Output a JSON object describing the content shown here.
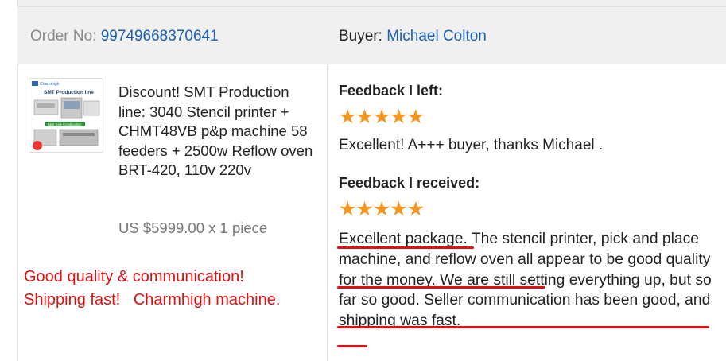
{
  "order": {
    "label": "Order No: ",
    "number": "99749668370641"
  },
  "buyer": {
    "label": "Buyer: ",
    "name": "Michael Colton"
  },
  "product": {
    "title": "Discount! SMT Production line: 3040 Stencil printer + CHMT48VB p&p machine 58 feeders + 2500w Reflow oven BRT-420, 110v 220v",
    "price": "US $5999.00 x 1 piece",
    "image": {
      "logo_text": "Charmhigh",
      "banner": "SMT Production line",
      "badge": "Best Sale Combination"
    }
  },
  "promo": {
    "line1": "Good quality & communication!",
    "line2": "Shipping fast!   Charmhigh machine."
  },
  "feedback_left": {
    "heading": "Feedback I left:",
    "rating": 5,
    "stars": "★★★★★",
    "text": "Excellent! A+++ buyer, thanks Michael ."
  },
  "feedback_received": {
    "heading": "Feedback I received:",
    "rating": 5,
    "stars": "★★★★★",
    "text": "Excellent package. The stencil printer, pick and place machine, and reflow oven all appear to be good quality for the money. We are still setting everything up, but so far so good. Seller communication has been good, and shipping was fast."
  },
  "colors": {
    "link": "#1a5fb4",
    "promo": "#e01010",
    "star": "#f7941d",
    "underline": "#e01010"
  }
}
